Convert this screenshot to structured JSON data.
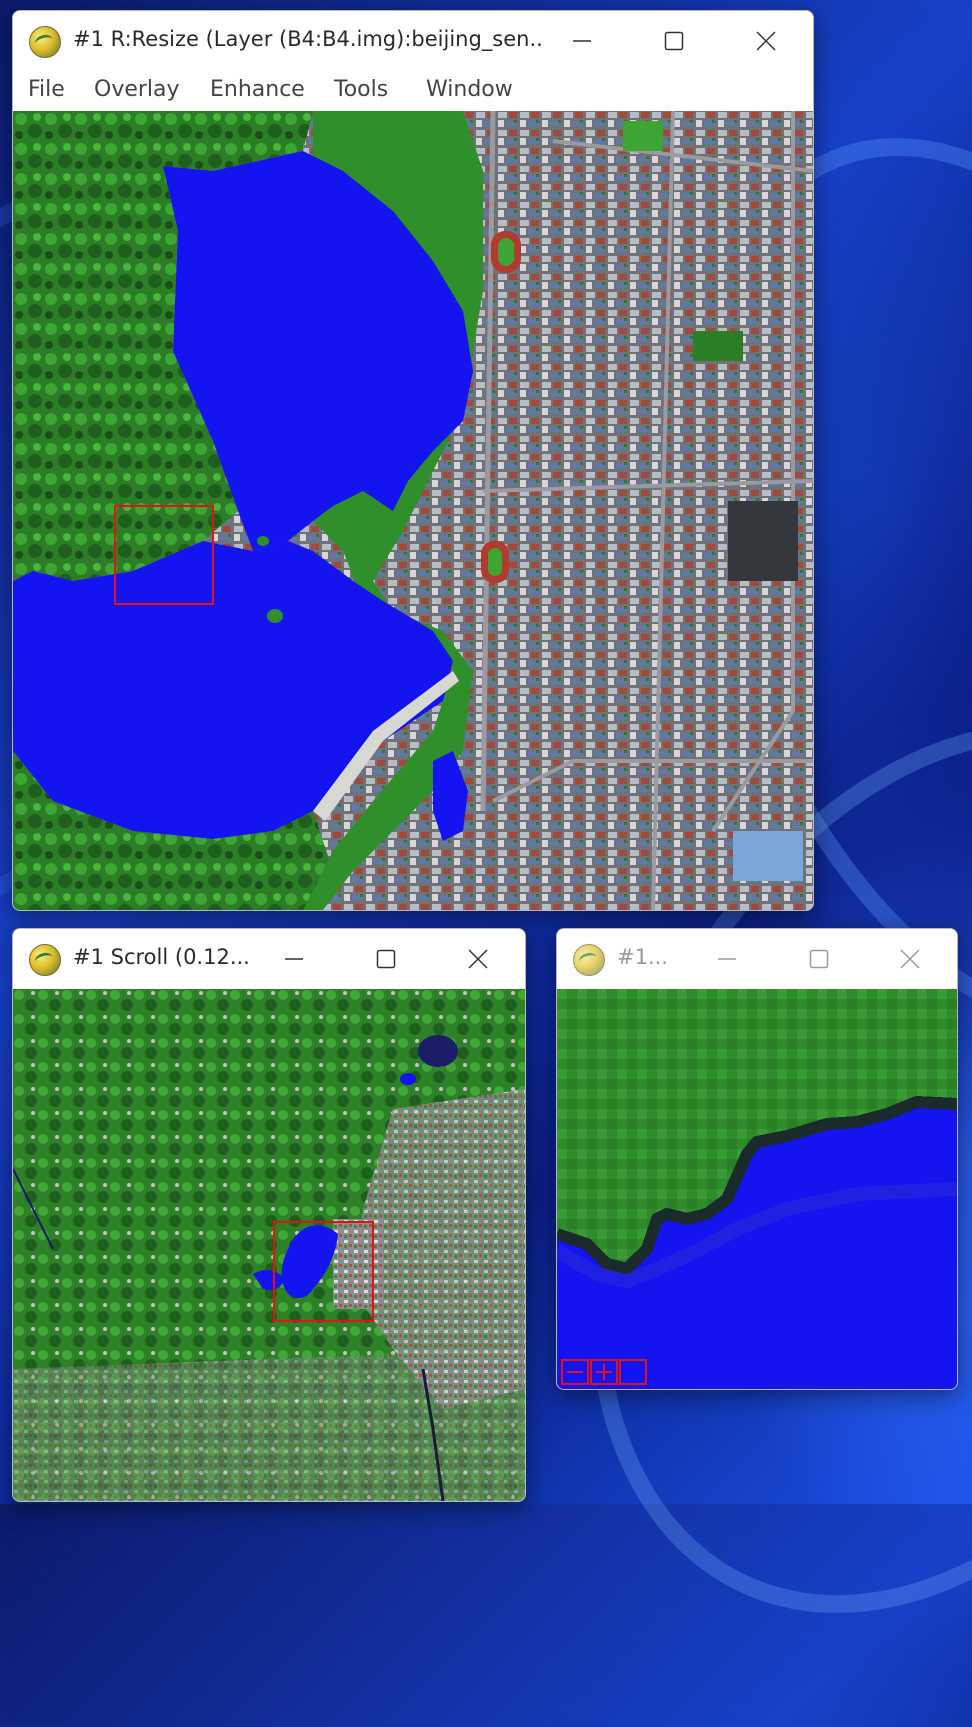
{
  "windows": {
    "image": {
      "title": "#1 R:Resize (Layer (B4:B4.img):beijing_sen...",
      "menu": [
        "File",
        "Overlay",
        "Enhance",
        "Tools",
        "Window"
      ]
    },
    "scroll": {
      "title": "#1 Scroll (0.12..."
    },
    "zoom": {
      "title": "#1..."
    }
  },
  "icons": {
    "app": "envi-globe-icon",
    "minimize": "minimize-icon",
    "maximize": "maximize-icon",
    "close": "close-icon",
    "zoom_out": "zoom-out-icon",
    "zoom_in": "zoom-in-icon",
    "zoom_reset": "zoom-reset-icon"
  },
  "colors": {
    "water": "#1414f0",
    "vegetation": "#2f8a2a",
    "selection": "#e31313"
  }
}
